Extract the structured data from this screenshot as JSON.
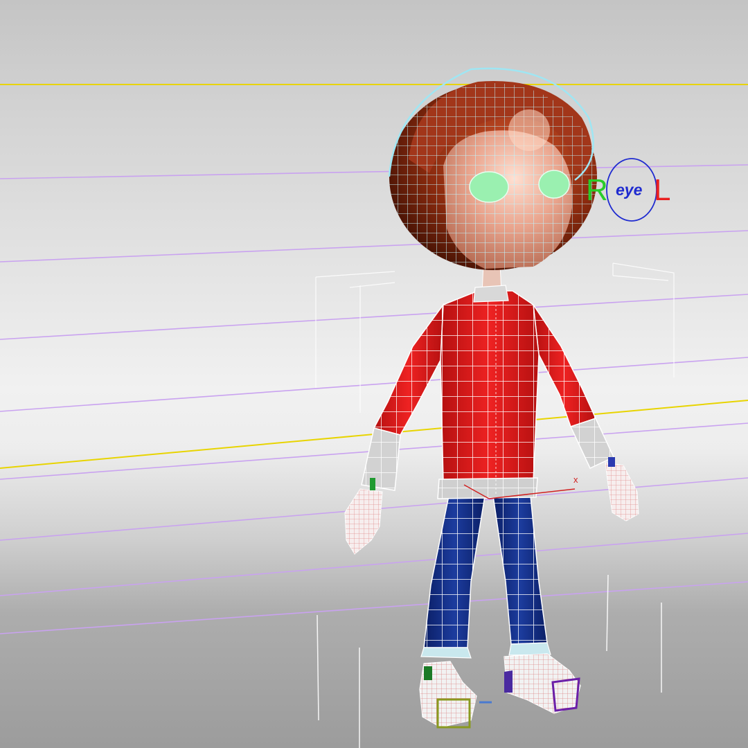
{
  "viewport": {
    "colors": {
      "grid_yellow": "#e8d400",
      "grid_violet": "#c9a2f0",
      "wire": "#ffffff",
      "head_wire": "#a8eaf5",
      "hair": "#8a2a0e",
      "skin": "#e9a892",
      "eyes": "#9af0b0",
      "shirt": "#dd1b1b",
      "cuff": "#c8c8c8",
      "pants": "#14318a",
      "eye_control": "#1f2bd0",
      "label_r": "#29cc29",
      "label_l": "#ea1f1f"
    }
  },
  "eye_control": {
    "left_label": "R",
    "center_label": "eye",
    "right_label": "L"
  },
  "pivot_marker": "x",
  "icons": [
    "eye-control-circle",
    "transform-gizmo"
  ]
}
